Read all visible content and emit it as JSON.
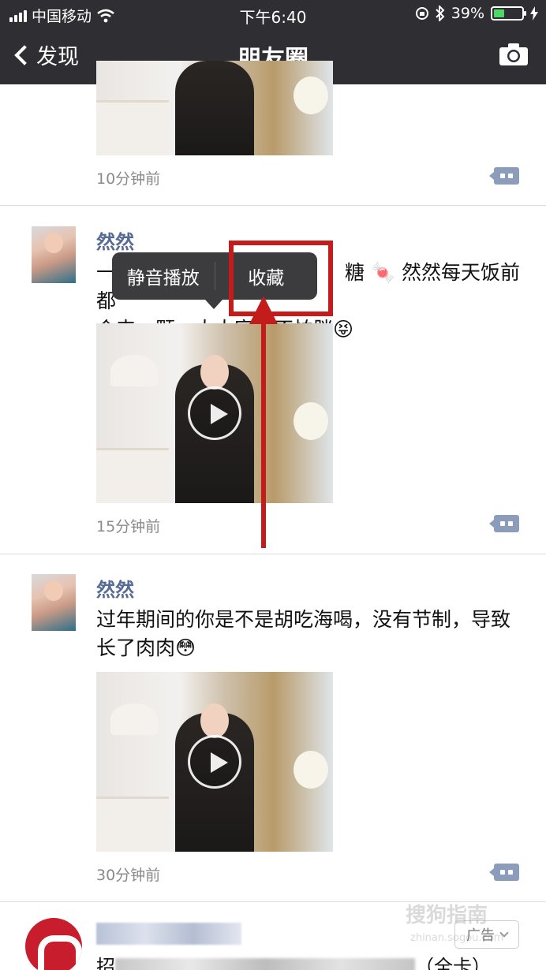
{
  "status_bar": {
    "carrier": "中国移动",
    "time": "下午6:40",
    "battery": "39%",
    "battery_level": 0.39
  },
  "nav": {
    "back_label": "发现",
    "title": "朋友圈"
  },
  "posts": [
    {
      "time": "10分钟前"
    },
    {
      "author": "然然",
      "text_line1": "一",
      "text_line1_end": "糖 🍬 然然每天饭前都",
      "text_line2": "会来一颗，大大家吃不怕胖😝",
      "time": "15分钟前"
    },
    {
      "author": "然然",
      "text": "过年期间的你是不是胡吃海喝，没有节制，导致长了肉肉😳",
      "time": "30分钟前"
    }
  ],
  "popup_menu": {
    "mute_play": "静音播放",
    "favorite": "收藏"
  },
  "ad": {
    "line_prefix": "招",
    "line_suffix": "（全卡）",
    "tag": "广告"
  },
  "watermark": {
    "text": "搜狗指南",
    "sub": "zhinan.sogou.com"
  },
  "colors": {
    "nav_bg": "#2f2f33",
    "name_link": "#576b95",
    "highlight": "#c41b1b"
  }
}
